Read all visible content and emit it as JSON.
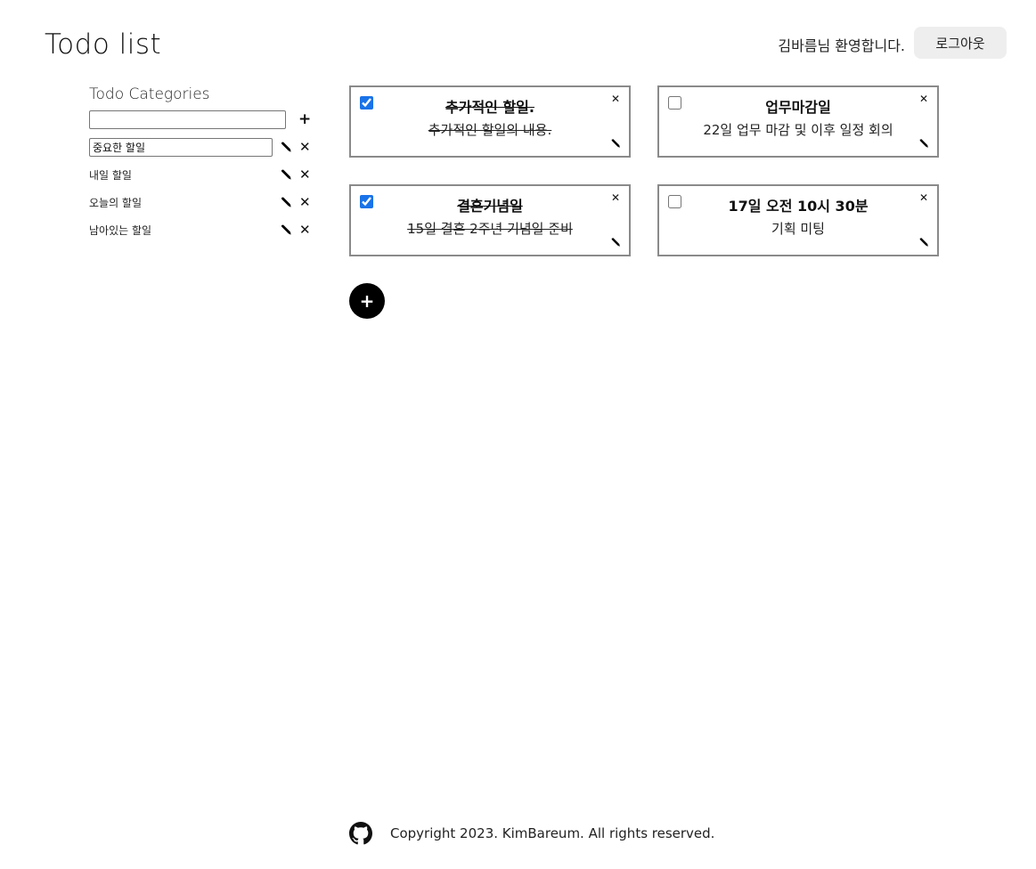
{
  "header": {
    "title": "Todo list",
    "welcome": "김바름님 환영합니다.",
    "logout_label": "로그아웃"
  },
  "sidebar": {
    "title": "Todo Categories",
    "new_category_value": "",
    "categories": [
      {
        "label": "중요한 할일",
        "editing": true
      },
      {
        "label": "내일 할일",
        "editing": false
      },
      {
        "label": "오늘의 할일",
        "editing": false
      },
      {
        "label": "남아있는 할일",
        "editing": false
      }
    ]
  },
  "todos": [
    {
      "title": "추가적인 할일.",
      "body": "추가적인 할일의 내용.",
      "done": true
    },
    {
      "title": "업무마감일",
      "body": "22일 업무 마감 및 이후 일정 회의",
      "done": false
    },
    {
      "title": "결혼기념일",
      "body": "15일 결혼 2주년 기념일 준비",
      "done": true
    },
    {
      "title": "17일 오전 10시 30분",
      "body": "기획 미팅",
      "done": false
    }
  ],
  "add_todo_label": "+",
  "footer": {
    "copyright": "Copyright 2023. KimBareum. All rights reserved.",
    "icon": "github-icon"
  },
  "colors": {
    "checkbox_accent": "#1a73e8",
    "card_border": "#8a8a8a",
    "logout_bg": "#eeeeee"
  }
}
